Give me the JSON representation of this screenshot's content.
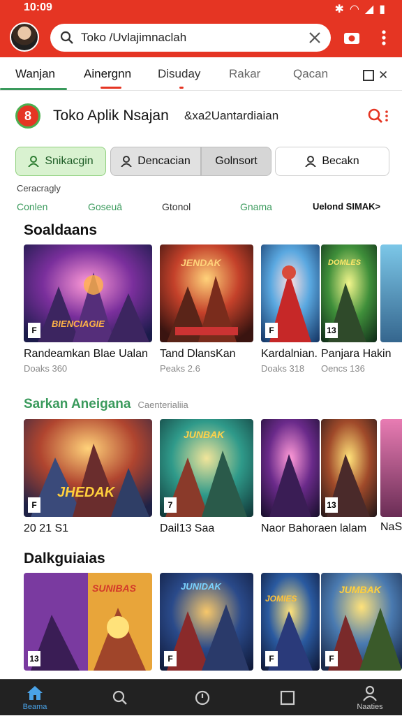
{
  "status": {
    "time": "10:09"
  },
  "search": {
    "value": "Toko /Uvlajimnaclah",
    "placeholder": "Toko /Uvlajimnaclah"
  },
  "tabs": [
    "Wanjan",
    "Ainergnn",
    "Disuday",
    "Rakar",
    "Qacan"
  ],
  "header": {
    "logo_glyph": "8",
    "title": "Toko Aplik Nsajan",
    "subtitle": "&xa2Uantardiaian"
  },
  "chips": [
    "Snikacgin",
    "Dencacian",
    "Golnsort",
    "Becakn"
  ],
  "note": "Ceracragly",
  "filters": [
    "Conlen",
    "Goseuā",
    "Gtonol",
    "Gnama",
    "Uelond SIMAK>"
  ],
  "sections": [
    {
      "title": "Soaldaans",
      "hint": "",
      "cards": [
        {
          "title": "Randeamkan Blae Ualan",
          "sub": "Doaks 360",
          "badge": "F",
          "banner": "BIENCIAGIE"
        },
        {
          "title": "Tand DlansKan",
          "sub": "Peaks 2.6",
          "badge": "",
          "banner": "JENDAK"
        },
        {
          "title": "Kardalnian.",
          "sub": "Doaks 318",
          "badge": "F",
          "banner": ""
        },
        {
          "title": "Panjara Hakin",
          "sub": "Oencs 136",
          "badge": "13",
          "banner": "DOMLES"
        }
      ]
    },
    {
      "title": "Sarkan Aneigana",
      "hint": "Caenterialiia",
      "cards": [
        {
          "title": "20 21 S1",
          "sub": "",
          "badge": "F",
          "banner": "JHEDAK"
        },
        {
          "title": "Dail13 Saa",
          "sub": "",
          "badge": "7",
          "banner": "JUNBAK"
        },
        {
          "title": "Naor Bahoraen lalam",
          "sub": "",
          "badge": "",
          "banner": ""
        },
        {
          "title": "NaS",
          "sub": "",
          "badge": "13",
          "banner": ""
        }
      ]
    },
    {
      "title": "Dalkguiaias",
      "hint": "",
      "cards": [
        {
          "title": "",
          "sub": "",
          "badge": "13",
          "banner": "SUNIBAS"
        },
        {
          "title": "",
          "sub": "",
          "badge": "F",
          "banner": "JUNIDAK"
        },
        {
          "title": "",
          "sub": "",
          "badge": "F",
          "banner": "JOMIES"
        },
        {
          "title": "",
          "sub": "",
          "badge": "F",
          "banner": "JUMBAK"
        }
      ]
    }
  ],
  "bottomnav": [
    {
      "label": "Beama",
      "icon": "home-icon"
    },
    {
      "label": "",
      "icon": "search-icon"
    },
    {
      "label": "",
      "icon": "clock-icon"
    },
    {
      "label": "",
      "icon": "square-icon"
    },
    {
      "label": "Naaties",
      "icon": "profile-icon"
    }
  ],
  "colors": {
    "accent": "#e53523",
    "green": "#4caf50",
    "chip_green_bg": "#d9f2d0",
    "chip_grey_bg": "#e1e1e1"
  }
}
